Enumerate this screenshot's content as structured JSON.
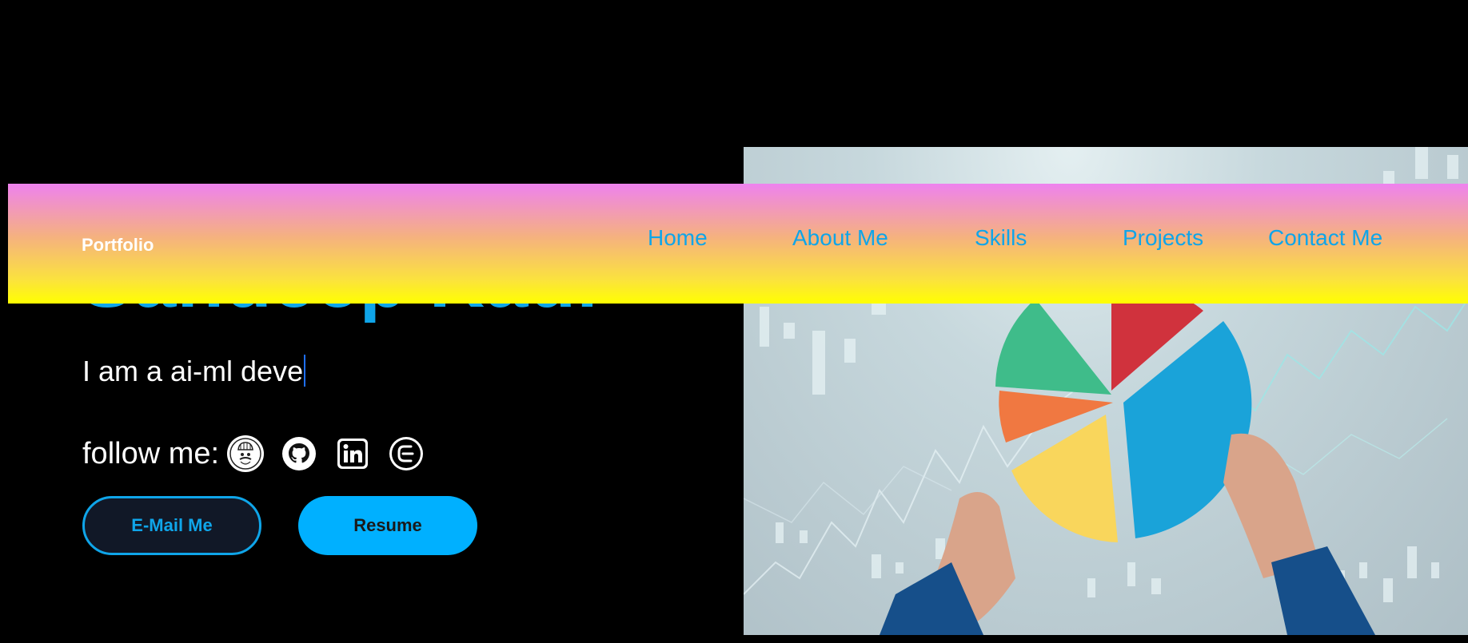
{
  "navbar": {
    "brand": "Portfolio",
    "items": [
      "Home",
      "About Me",
      "Skills",
      "Projects",
      "Contact Me"
    ]
  },
  "hero": {
    "name": "Sandeep Kaur",
    "typed_text": "I am a ai-ml deve",
    "follow_label": "follow me:",
    "socials": [
      "codechef-icon",
      "github-icon",
      "linkedin-icon",
      "leetcode-icon"
    ],
    "buttons": {
      "email": "E-Mail Me",
      "resume": "Resume"
    }
  },
  "colors": {
    "accent": "#0fa5e9",
    "resume_button": "#00b0ff",
    "nav_gradient_top": "#ee82ee",
    "nav_gradient_bottom": "#ffff00",
    "background": "#000000"
  },
  "image": {
    "alt": "hands holding pie chart over stock market graph"
  }
}
